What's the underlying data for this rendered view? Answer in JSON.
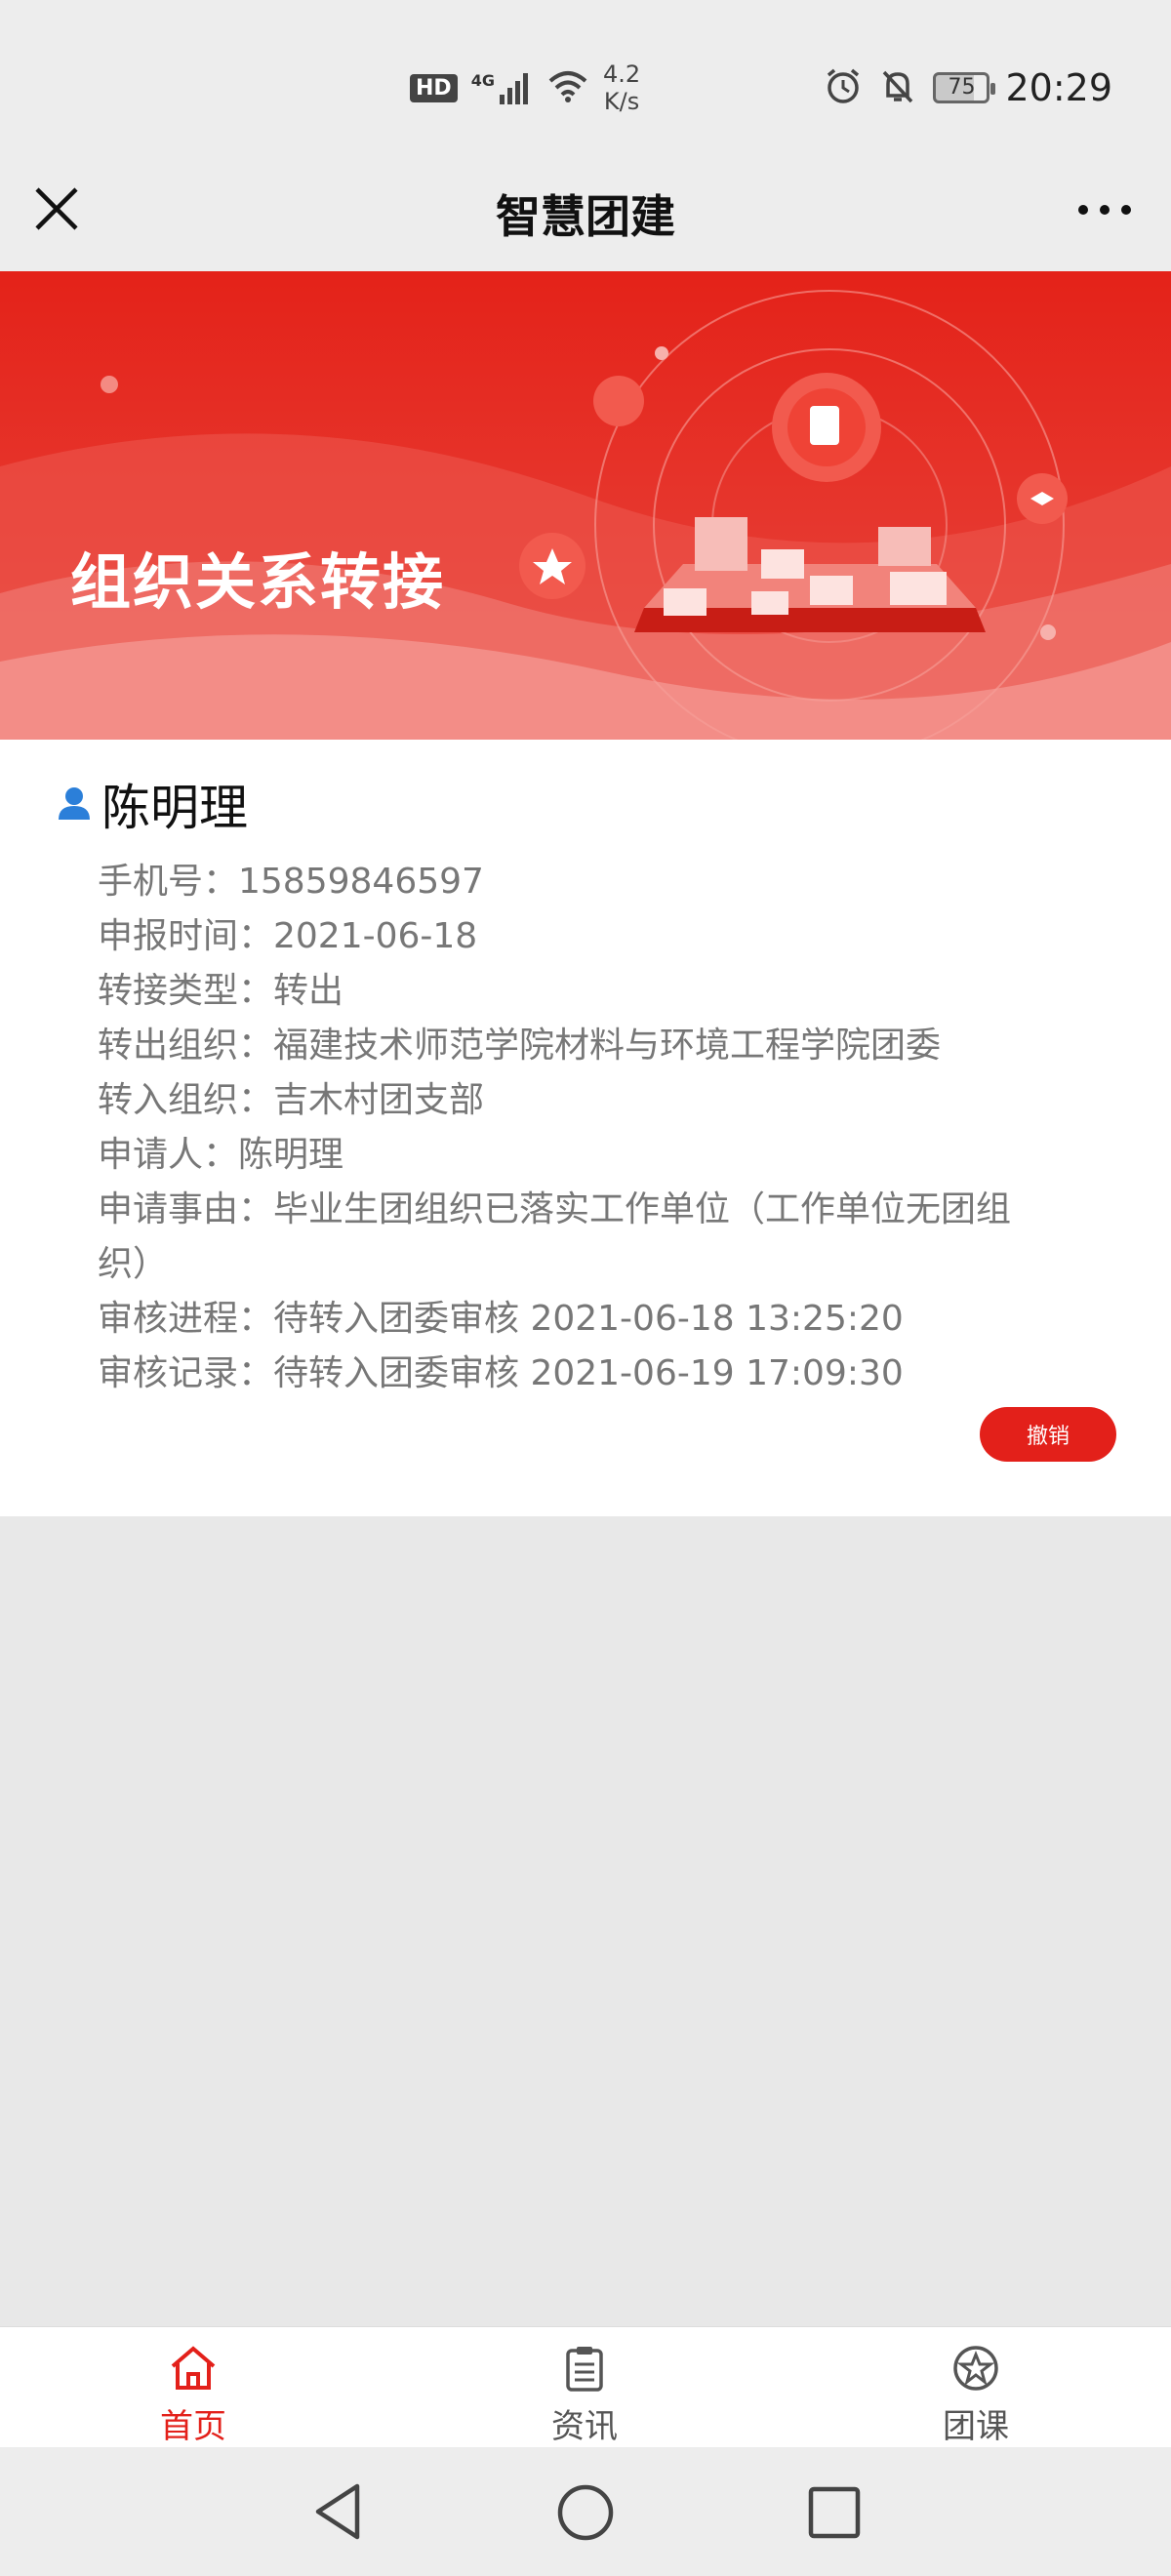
{
  "status_bar": {
    "hd": "HD",
    "network": "4G",
    "speed_value": "4.2",
    "speed_unit": "K/s",
    "battery": "75",
    "time": "20:29"
  },
  "header": {
    "title": "智慧团建"
  },
  "banner": {
    "title": "组织关系转接"
  },
  "record": {
    "name": "陈明理",
    "rows": [
      "手机号：15859846597",
      "申报时间：2021-06-18",
      "转接类型：转出",
      "转出组织：福建技术师范学院材料与环境工程学院团委",
      "转入组织：吉木村团支部",
      "申请人：陈明理",
      "申请事由：毕业生团组织已落实工作单位（工作单位无团组",
      "织）",
      "审核进程：待转入团委审核 2021-06-18 13:25:20",
      "审核记录：待转入团委审核 2021-06-19 17:09:30"
    ],
    "revoke_label": "撤销"
  },
  "bottom_nav": {
    "items": [
      {
        "label": "首页",
        "icon": "home-icon",
        "active": true
      },
      {
        "label": "资讯",
        "icon": "news-icon",
        "active": false
      },
      {
        "label": "团课",
        "icon": "star-badge-icon",
        "active": false
      }
    ]
  },
  "colors": {
    "accent": "#e3201a",
    "muted_text": "#777777",
    "background": "#e8e8e8"
  }
}
